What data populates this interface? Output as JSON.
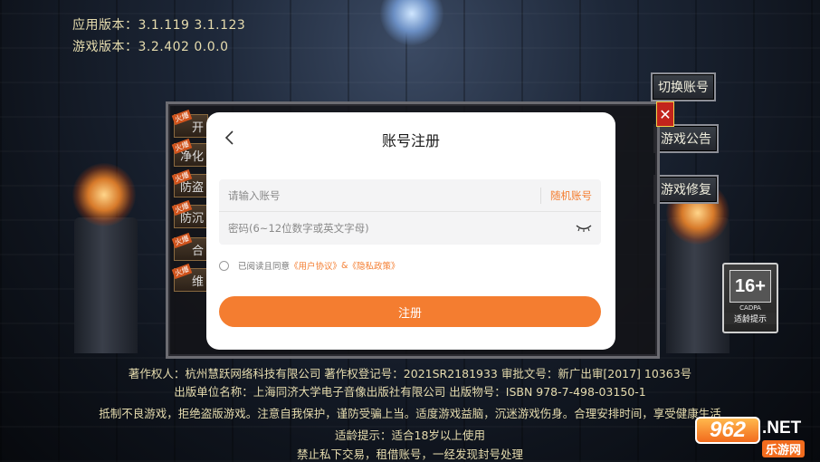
{
  "app": {
    "app_version": "应用版本：3.1.119  3.1.123",
    "game_version": "游戏版本：3.2.402  0.0.0"
  },
  "right_buttons": {
    "switch_account": "切换账号",
    "game_notice": "游戏公告",
    "game_repair": "游戏修复"
  },
  "game_panel": {
    "close": "✕",
    "side_items": [
      {
        "tag": "火爆",
        "label": "开"
      },
      {
        "tag": "火爆",
        "label": "净化"
      },
      {
        "tag": "火爆",
        "label": "防盗"
      },
      {
        "tag": "火爆",
        "label": "防沉"
      },
      {
        "tag": "火爆",
        "label": "合"
      },
      {
        "tag": "火爆",
        "label": "维"
      }
    ]
  },
  "modal": {
    "title": "账号注册",
    "account_placeholder": "请输入账号",
    "random_account": "随机账号",
    "password_placeholder": "密码(6~12位数字或英文字母)",
    "agree_prefix": "已阅读且同意",
    "user_agreement": "《用户协议》",
    "and": "&",
    "privacy_policy": "《隐私政策》",
    "submit": "注册"
  },
  "age_rating": {
    "number": "16+",
    "cadpa": "CADPA",
    "tip": "适龄提示"
  },
  "footer": {
    "line1": "著作权人：杭州慧跃网络科技有限公司  著作权登记号：2021SR2181933  审批文号：新广出审[2017] 10363号",
    "line2": "出版单位名称：上海同济大学电子音像出版社有限公司       出版物号：ISBN 978-7-498-03150-1",
    "line3": "抵制不良游戏，拒绝盗版游戏。注意自我保护，谨防受骗上当。适度游戏益脑，沉迷游戏伤身。合理安排时间，享受健康生活",
    "line4": "适龄提示：适合18岁以上使用",
    "line5": "禁止私下交易，租借账号，一经发现封号处理"
  },
  "watermark": {
    "number": "962",
    "net": ".NET",
    "cn": "乐游网"
  },
  "colors": {
    "accent": "#f47d30",
    "footer_text": "#e6dcae",
    "close_red": "#c2241c"
  }
}
